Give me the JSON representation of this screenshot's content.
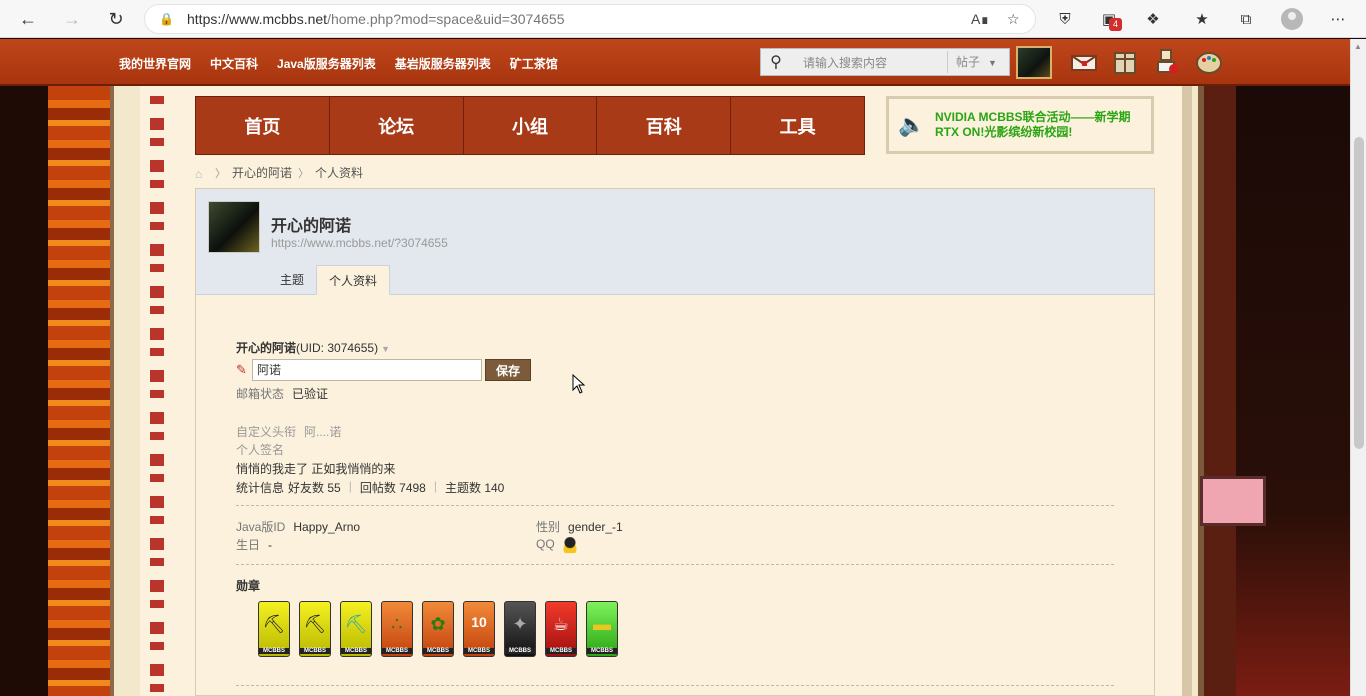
{
  "browser": {
    "url_host": "https://www.mcbbs.net",
    "url_path": "/home.php?mod=space&uid=3074655",
    "extension_badge": "4"
  },
  "topbar": {
    "links": [
      "我的世界官网",
      "中文百科",
      "Java版服务器列表",
      "基岩版服务器列表",
      "矿工茶馆"
    ],
    "search_placeholder": "请输入搜索内容",
    "search_scope": "帖子"
  },
  "main_nav": [
    "首页",
    "论坛",
    "小组",
    "百科",
    "工具"
  ],
  "notice": "NVIDIA MCBBS联合活动——新学期RTX ON!光影缤纷新校园!",
  "breadcrumb": [
    "开心的阿诺",
    "个人资料"
  ],
  "profile": {
    "name": "开心的阿诺",
    "url": "https://www.mcbbs.net/?3074655",
    "tabs": [
      "主题",
      "个人资料"
    ],
    "uid_name": "开心的阿诺",
    "uid_label": "(UID: 3074655)",
    "nickname_value": "阿诺",
    "save_label": "保存",
    "email_status_label": "邮箱状态",
    "email_status_value": "已验证",
    "custom_title_label": "自定义头衔",
    "custom_title_value": "阿....诺",
    "signature_label": "个人签名",
    "signature_value": "悄悄的我走了 正如我悄悄的来",
    "stats_label": "统计信息",
    "friends": "好友数 55",
    "replies": "回帖数 7498",
    "topics": "主题数 140",
    "java_id_label": "Java版ID",
    "java_id_value": "Happy_Arno",
    "gender_label": "性别",
    "gender_value": "gender_-1",
    "birthday_label": "生日",
    "birthday_value": "-",
    "qq_label": "QQ",
    "medals_label": "勋章",
    "medal_caption": "MCBBS"
  },
  "colors": {
    "topbar": "#b13f16",
    "nav": "#a83a18",
    "notice_text": "#2aa513",
    "panel_head": "#e3e8ef"
  }
}
